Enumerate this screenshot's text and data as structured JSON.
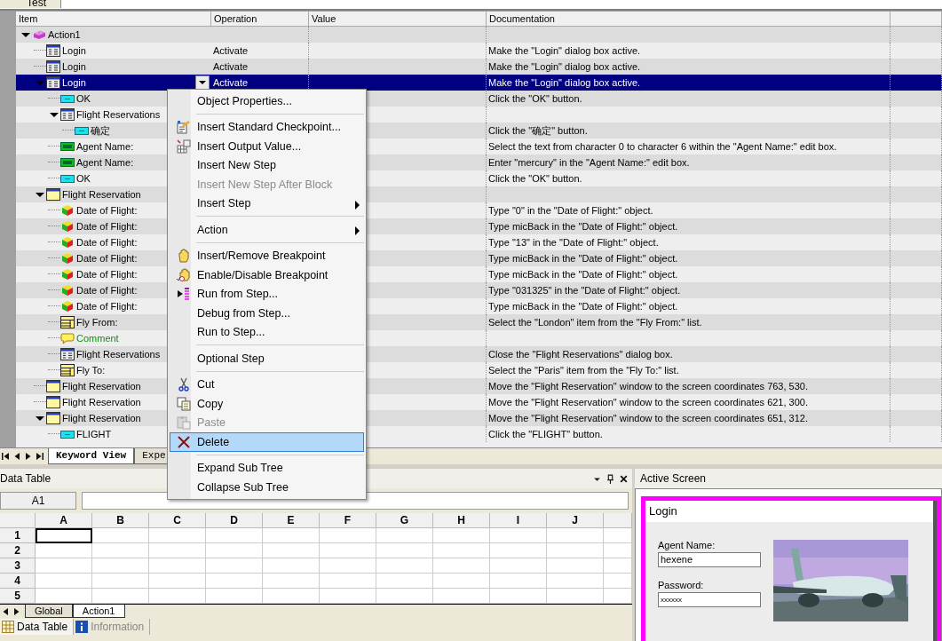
{
  "document_tab": {
    "label": "Test"
  },
  "keyword_view": {
    "columns": [
      "Item",
      "Operation",
      "Value",
      "Documentation"
    ],
    "rows": [
      {
        "item": "Action1",
        "kind": "action",
        "expanded": true,
        "selected": false,
        "children": [
          {
            "item": "Login",
            "kind": "dialog",
            "operation": "Activate",
            "documentation": "Make the \"Login\" dialog box active.",
            "selected": false
          },
          {
            "item": "Login",
            "kind": "dialog",
            "operation": "Activate",
            "documentation": "Make the \"Login\" dialog box active.",
            "selected": false
          },
          {
            "item": "Login",
            "kind": "dialog",
            "operation": "Activate",
            "documentation": "Make the \"Login\" dialog box active.",
            "selected": true,
            "expanded": true,
            "children": [
              {
                "item": "OK",
                "kind": "button",
                "documentation": "Click the \"OK\" button.",
                "selected": false
              },
              {
                "item": "Flight Reservations",
                "kind": "dialog",
                "selected": false,
                "expanded": true,
                "children": [
                  {
                    "item": "确定",
                    "kind": "button",
                    "documentation": "Click the \"确定\" button.",
                    "selected": false
                  }
                ]
              },
              {
                "item": "Agent Name:",
                "kind": "edit",
                "documentation": "Select the text from character 0 to character 6 within the \"Agent Name:\" edit box.",
                "selected": false
              },
              {
                "item": "Agent Name:",
                "kind": "edit",
                "documentation": "Enter \"mercury\" in the \"Agent Name:\" edit box.",
                "selected": false
              },
              {
                "item": "OK",
                "kind": "button",
                "documentation": "Click the \"OK\" button.",
                "selected": false
              }
            ]
          },
          {
            "item": "Flight Reservation",
            "kind": "window",
            "selected": false,
            "expanded": true,
            "children": [
              {
                "item": "Date of Flight:",
                "kind": "cube",
                "documentation": "Type \"0\" in the \"Date of Flight:\" object.",
                "selected": false
              },
              {
                "item": "Date of Flight:",
                "kind": "cube",
                "documentation": "Type micBack in the \"Date of Flight:\" object.",
                "selected": false
              },
              {
                "item": "Date of Flight:",
                "kind": "cube",
                "documentation": "Type \"13\" in the \"Date of Flight:\" object.",
                "selected": false
              },
              {
                "item": "Date of Flight:",
                "kind": "cube",
                "documentation": "Type micBack in the \"Date of Flight:\" object.",
                "selected": false
              },
              {
                "item": "Date of Flight:",
                "kind": "cube",
                "documentation": "Type micBack in the \"Date of Flight:\" object.",
                "selected": false
              },
              {
                "item": "Date of Flight:",
                "kind": "cube",
                "documentation": "Type \"031325\" in the \"Date of Flight:\" object.",
                "selected": false
              },
              {
                "item": "Date of Flight:",
                "kind": "cube",
                "documentation": "Type micBack in the \"Date of Flight:\" object.",
                "selected": false
              },
              {
                "item": "Fly From:",
                "kind": "list",
                "documentation": "Select the \"London\" item from the \"Fly From:\" list.",
                "selected": false
              },
              {
                "item": "Comment",
                "kind": "comment",
                "selected": false
              },
              {
                "item": "Flight Reservations",
                "kind": "dialog",
                "documentation": "Close the \"Flight Reservations\" dialog box.",
                "selected": false
              },
              {
                "item": "Fly To:",
                "kind": "list",
                "documentation": "Select the \"Paris\" item from the \"Fly To:\" list.",
                "selected": false
              }
            ]
          },
          {
            "item": "Flight Reservation",
            "kind": "window",
            "documentation": "Move the \"Flight Reservation\" window to the screen coordinates 763, 530.",
            "selected": false
          },
          {
            "item": "Flight Reservation",
            "kind": "window",
            "documentation": "Move the \"Flight Reservation\" window to the screen coordinates 621, 300.",
            "selected": false
          },
          {
            "item": "Flight Reservation",
            "kind": "window",
            "documentation": "Move the \"Flight Reservation\" window to the screen coordinates 651, 312.",
            "selected": false,
            "expanded": true,
            "children": [
              {
                "item": "FLIGHT",
                "kind": "button",
                "documentation": "Click the \"FLIGHT\" button.",
                "selected": false
              }
            ]
          }
        ]
      }
    ]
  },
  "context_menu": {
    "items": [
      {
        "kind": "plain",
        "label": "Object Properties...",
        "disabled": false,
        "selected": false,
        "submenu": false
      },
      {
        "kind": "separator"
      },
      {
        "kind": "checkpoint",
        "label": "Insert Standard Checkpoint...",
        "disabled": false,
        "selected": false,
        "submenu": false
      },
      {
        "kind": "output",
        "label": "Insert Output Value...",
        "disabled": false,
        "selected": false,
        "submenu": false
      },
      {
        "kind": "plain",
        "label": "Insert New Step",
        "disabled": false,
        "selected": false,
        "submenu": false
      },
      {
        "kind": "plain",
        "label": "Insert New Step After Block",
        "disabled": true,
        "selected": false,
        "submenu": false
      },
      {
        "kind": "plain",
        "label": "Insert Step",
        "disabled": false,
        "selected": false,
        "submenu": true
      },
      {
        "kind": "separator"
      },
      {
        "kind": "plain",
        "label": "Action",
        "disabled": false,
        "selected": false,
        "submenu": true
      },
      {
        "kind": "separator"
      },
      {
        "kind": "hand",
        "label": "Insert/Remove Breakpoint",
        "disabled": false,
        "selected": false,
        "submenu": false
      },
      {
        "kind": "hand-toggle",
        "label": "Enable/Disable Breakpoint",
        "disabled": false,
        "selected": false,
        "submenu": false
      },
      {
        "kind": "run",
        "label": "Run from Step...",
        "disabled": false,
        "selected": false,
        "submenu": false
      },
      {
        "kind": "plain",
        "label": "Debug from Step...",
        "disabled": false,
        "selected": false,
        "submenu": false
      },
      {
        "kind": "plain",
        "label": "Run to Step...",
        "disabled": false,
        "selected": false,
        "submenu": false
      },
      {
        "kind": "separator"
      },
      {
        "kind": "plain",
        "label": "Optional Step",
        "disabled": false,
        "selected": false,
        "submenu": false
      },
      {
        "kind": "separator"
      },
      {
        "kind": "cut",
        "label": "Cut",
        "disabled": false,
        "selected": false,
        "submenu": false
      },
      {
        "kind": "copy",
        "label": "Copy",
        "disabled": false,
        "selected": false,
        "submenu": false
      },
      {
        "kind": "paste",
        "label": "Paste",
        "disabled": true,
        "selected": false,
        "submenu": false
      },
      {
        "kind": "delete",
        "label": "Delete",
        "disabled": false,
        "selected": true,
        "submenu": false
      },
      {
        "kind": "separator"
      },
      {
        "kind": "plain",
        "label": "Expand Sub Tree",
        "disabled": false,
        "selected": false,
        "submenu": false
      },
      {
        "kind": "plain",
        "label": "Collapse Sub Tree",
        "disabled": false,
        "selected": false,
        "submenu": false
      }
    ]
  },
  "view_tabs": [
    {
      "label": "Keyword View",
      "selected": true
    },
    {
      "label": "Expe",
      "selected": false
    }
  ],
  "data_table": {
    "title": "Data Table",
    "cell_ref": "A1",
    "columns": [
      {
        "label": "A",
        "selected": true
      },
      {
        "label": "B",
        "selected": false
      },
      {
        "label": "C",
        "selected": false
      },
      {
        "label": "D",
        "selected": false
      },
      {
        "label": "E",
        "selected": false
      },
      {
        "label": "F",
        "selected": false
      },
      {
        "label": "G",
        "selected": false
      },
      {
        "label": "H",
        "selected": false
      },
      {
        "label": "I",
        "selected": false
      },
      {
        "label": "J",
        "selected": false
      }
    ],
    "rows": [
      {
        "label": "1",
        "selected": true
      },
      {
        "label": "2",
        "selected": false
      },
      {
        "label": "3",
        "selected": false
      },
      {
        "label": "4",
        "selected": false
      },
      {
        "label": "5",
        "selected": false
      }
    ],
    "sheets": [
      {
        "label": "Global",
        "selected": false
      },
      {
        "label": "Action1",
        "selected": true
      }
    ]
  },
  "bottom_tabs": [
    {
      "label": "Data Table",
      "kind": "grid",
      "selected": true
    },
    {
      "label": "Information",
      "kind": "info",
      "selected": false
    }
  ],
  "active_screen": {
    "title": "Active Screen",
    "dialog": {
      "title": "Login",
      "fields": [
        {
          "label": "Agent Name:",
          "value": "hexene"
        },
        {
          "label": "Password:",
          "value": "xxxxxx"
        }
      ]
    }
  }
}
